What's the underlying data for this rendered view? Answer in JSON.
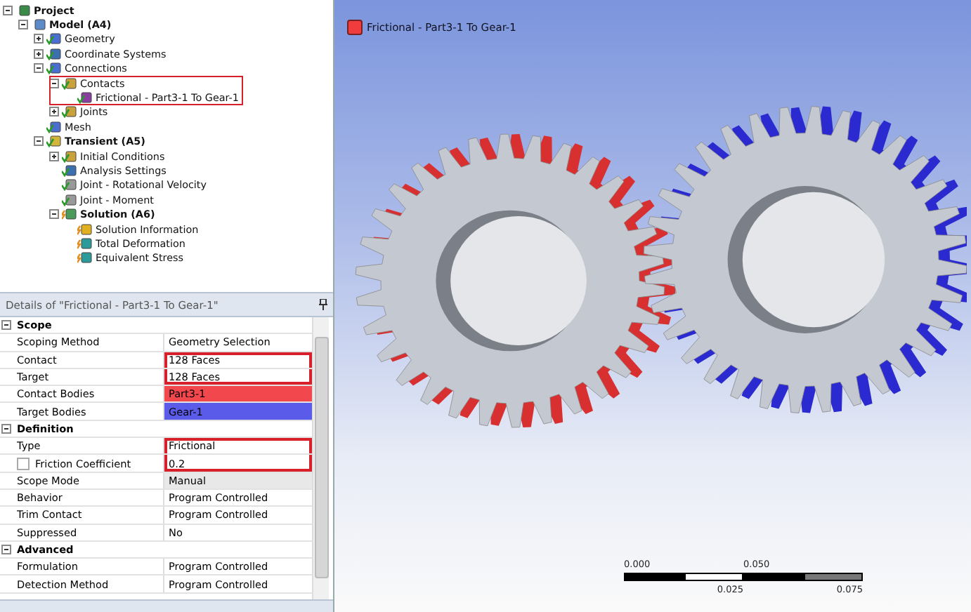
{
  "tree": [
    {
      "label": "Project",
      "bold": true,
      "kind": "project",
      "expanded": true,
      "children": [
        {
          "label": "Model (A4)",
          "bold": true,
          "kind": "model",
          "expanded": true,
          "children": [
            {
              "label": "Geometry",
              "kind": "geometry",
              "ok": true,
              "expanded": false
            },
            {
              "label": "Coordinate Systems",
              "kind": "axes",
              "ok": true,
              "expanded": false
            },
            {
              "label": "Connections",
              "kind": "geometry",
              "ok": true,
              "expanded": true,
              "children": [
                {
                  "label": "Contacts",
                  "kind": "folder",
                  "ok": true,
                  "expanded": true,
                  "annotated": true,
                  "children": [
                    {
                      "label": "Frictional - Part3-1 To Gear-1",
                      "kind": "contact",
                      "ok": true
                    }
                  ]
                },
                {
                  "label": "Joints",
                  "kind": "folder",
                  "ok": true,
                  "expanded": false
                }
              ]
            },
            {
              "label": "Mesh",
              "kind": "geometry",
              "ok": true
            },
            {
              "label": "Transient (A5)",
              "bold": true,
              "kind": "analysis",
              "ok": true,
              "expanded": true,
              "children": [
                {
                  "label": "Initial Conditions",
                  "kind": "folder",
                  "ok": true,
                  "expanded": false
                },
                {
                  "label": "Analysis Settings",
                  "kind": "axes",
                  "ok": true
                },
                {
                  "label": "Joint - Rotational Velocity",
                  "kind": "joint",
                  "ok": true
                },
                {
                  "label": "Joint - Moment",
                  "kind": "joint",
                  "ok": true
                },
                {
                  "label": "Solution (A6)",
                  "bold": true,
                  "kind": "solution",
                  "ok": false,
                  "expanded": true,
                  "children": [
                    {
                      "label": "Solution Information",
                      "kind": "info",
                      "ok": false
                    },
                    {
                      "label": "Total Deformation",
                      "kind": "result",
                      "ok": false
                    },
                    {
                      "label": "Equivalent Stress",
                      "kind": "result",
                      "ok": false
                    }
                  ]
                }
              ]
            }
          ]
        }
      ]
    }
  ],
  "details": {
    "title": "Details of \"Frictional - Part3-1 To Gear-1\"",
    "rows": [
      {
        "kind": "group",
        "label": "Scope",
        "expanded": true
      },
      {
        "kind": "prop",
        "label": "Scoping Method",
        "value": "Geometry Selection"
      },
      {
        "kind": "prop",
        "label": "Contact",
        "value": "128 Faces",
        "annotated": true
      },
      {
        "kind": "prop",
        "label": "Target",
        "value": "128 Faces",
        "annotated": true
      },
      {
        "kind": "prop",
        "label": "Contact Bodies",
        "value": "Part3-1",
        "color": "#f2474d"
      },
      {
        "kind": "prop",
        "label": "Target Bodies",
        "value": "Gear-1",
        "color": "#5b5bea"
      },
      {
        "kind": "group",
        "label": "Definition",
        "expanded": true
      },
      {
        "kind": "prop",
        "label": "Type",
        "value": "Frictional",
        "annotated": true
      },
      {
        "kind": "param",
        "label": "Friction Coefficient",
        "value": "0.2",
        "annotated": true,
        "checked": false
      },
      {
        "kind": "prop",
        "label": "Scope Mode",
        "value": "Manual",
        "readonly": true
      },
      {
        "kind": "prop",
        "label": "Behavior",
        "value": "Program Controlled"
      },
      {
        "kind": "prop",
        "label": "Trim Contact",
        "value": "Program Controlled"
      },
      {
        "kind": "prop",
        "label": "Suppressed",
        "value": "No"
      },
      {
        "kind": "group",
        "label": "Advanced",
        "expanded": true
      },
      {
        "kind": "prop",
        "label": "Formulation",
        "value": "Program Controlled"
      },
      {
        "kind": "prop",
        "label": "Detection Method",
        "value": "Program Controlled"
      }
    ]
  },
  "viewport": {
    "legend": {
      "label": "Frictional - Part3-1 To Gear-1",
      "color": "#f03c3c"
    },
    "scale": {
      "labels": [
        "0.000",
        "0.025",
        "0.050",
        "0.075"
      ]
    }
  }
}
